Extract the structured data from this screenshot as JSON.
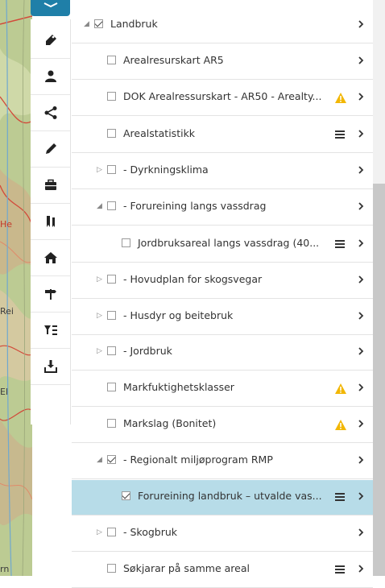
{
  "map": {
    "labels": [
      {
        "text": "He"
      },
      {
        "text": "Rei"
      },
      {
        "text": "El"
      },
      {
        "text": "rn"
      }
    ]
  },
  "toolbar": {
    "buttons": [
      {
        "icon": "layers-icon",
        "active": true
      },
      {
        "icon": "tag-icon"
      },
      {
        "icon": "person-icon"
      },
      {
        "icon": "share-icon"
      },
      {
        "icon": "pencil-icon"
      },
      {
        "icon": "briefcase-icon"
      },
      {
        "icon": "bookmark-icon"
      },
      {
        "icon": "home-icon"
      },
      {
        "icon": "signpost-icon"
      },
      {
        "icon": "filter-list-icon"
      },
      {
        "icon": "download-icon"
      }
    ]
  },
  "layers": [
    {
      "label": "Landbruk",
      "checked": true,
      "expand": "expanded",
      "warning": false,
      "legend": false
    },
    {
      "label": "Arealresurskart AR5",
      "checked": false,
      "expand": "none",
      "warning": false,
      "legend": false
    },
    {
      "label": "DOK Arealressurskart - AR50 - Arealty...",
      "checked": false,
      "expand": "none",
      "warning": true,
      "legend": false
    },
    {
      "label": "Arealstatistikk",
      "checked": false,
      "expand": "none",
      "warning": false,
      "legend": true
    },
    {
      "label": "- Dyrkningsklima",
      "checked": false,
      "expand": "collapsed",
      "warning": false,
      "legend": false
    },
    {
      "label": "- Forureining langs vassdrag",
      "checked": false,
      "expand": "expanded",
      "warning": false,
      "legend": false
    },
    {
      "label": "Jordbruksareal langs vassdrag (40...",
      "checked": false,
      "expand": "none",
      "warning": false,
      "legend": true
    },
    {
      "label": "- Hovudplan for skogsvegar",
      "checked": false,
      "expand": "collapsed",
      "warning": false,
      "legend": false
    },
    {
      "label": "- Husdyr og beitebruk",
      "checked": false,
      "expand": "collapsed",
      "warning": false,
      "legend": false
    },
    {
      "label": "- Jordbruk",
      "checked": false,
      "expand": "collapsed",
      "warning": false,
      "legend": false
    },
    {
      "label": "Markfuktighetsklasser",
      "checked": false,
      "expand": "none",
      "warning": true,
      "legend": false
    },
    {
      "label": "Markslag (Bonitet)",
      "checked": false,
      "expand": "none",
      "warning": true,
      "legend": false
    },
    {
      "label": "- Regionalt miljøprogram RMP",
      "checked": true,
      "expand": "expanded",
      "warning": false,
      "legend": false
    },
    {
      "label": "Forureining landbruk – utvalde vas...",
      "checked": true,
      "expand": "none",
      "warning": false,
      "legend": true,
      "selected": true
    },
    {
      "label": "- Skogbruk",
      "checked": false,
      "expand": "collapsed",
      "warning": false,
      "legend": false
    },
    {
      "label": "Søkjarar på samme areal",
      "checked": false,
      "expand": "none",
      "warning": false,
      "legend": true
    }
  ],
  "colors": {
    "accent": "#1f7fa8",
    "selected_row": "#b7dce8",
    "warning": "#f2b705"
  }
}
